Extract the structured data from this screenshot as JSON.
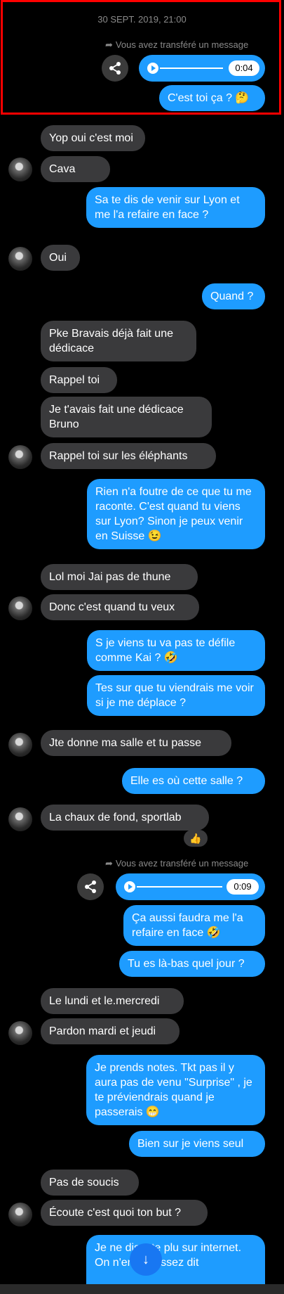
{
  "header": {
    "timestamp": "30 SEPT. 2019, 21:00"
  },
  "forward_notice": "Vous avez transféré un message",
  "icons": {
    "share": "share-icon",
    "play": "play-icon",
    "forward": "forward-arrow-icon",
    "scroll_down": "arrow-down-icon"
  },
  "colors": {
    "outgoing": "#1e9cff",
    "incoming": "#3a3a3c",
    "highlight": "#ff0000"
  },
  "audio": [
    {
      "duration": "0:04"
    },
    {
      "duration": "0:09"
    }
  ],
  "messages": [
    {
      "side": "out",
      "text": "C'est toi ça ? 🤔"
    },
    {
      "side": "in",
      "text": "Yop oui c'est moi"
    },
    {
      "side": "in",
      "text": "Cava"
    },
    {
      "side": "out",
      "text": "Sa te dis de venir sur Lyon et me l'a refaire en face ?"
    },
    {
      "side": "in",
      "text": "Oui"
    },
    {
      "side": "out",
      "text": "Quand ?"
    },
    {
      "side": "in",
      "text": "Pke Bravais déjà fait une dédicace"
    },
    {
      "side": "in",
      "text": "Rappel toi"
    },
    {
      "side": "in",
      "text": "Je t'avais fait une dédicace Bruno"
    },
    {
      "side": "in",
      "text": "Rappel toi sur les éléphants"
    },
    {
      "side": "out",
      "text": "Rien n'a foutre de ce que tu me raconte. C'est quand tu viens sur Lyon? Sinon je peux venir en Suisse 😉"
    },
    {
      "side": "in",
      "text": "Lol moi Jai pas de thune"
    },
    {
      "side": "in",
      "text": "Donc c'est quand tu veux"
    },
    {
      "side": "out",
      "text": "S je viens tu va pas te défile comme Kai ? 🤣"
    },
    {
      "side": "out",
      "text": "Tes sur que tu viendrais me voir si je me déplace ?"
    },
    {
      "side": "in",
      "text": "Jte donne ma salle et tu passe"
    },
    {
      "side": "out",
      "text": "Elle es où cette salle ?"
    },
    {
      "side": "in",
      "text": "La chaux de fond, sportlab"
    },
    {
      "side": "out",
      "text": "Ça aussi faudra me l'a refaire en face 🤣"
    },
    {
      "side": "out",
      "text": "Tu es là-bas quel jour ?"
    },
    {
      "side": "in",
      "text": "Le lundi et le.mercredi"
    },
    {
      "side": "in",
      "text": "Pardon mardi et jeudi"
    },
    {
      "side": "out",
      "text": "Je prends notes. Tkt pas il y aura pas de venu \"Surprise\" , je te préviendrais quand je passerais 😁"
    },
    {
      "side": "out",
      "text": "Bien sur je viens seul"
    },
    {
      "side": "in",
      "text": "Pas de soucis"
    },
    {
      "side": "in",
      "text": "Écoute c'est quoi ton but ?"
    },
    {
      "side": "out",
      "text": "Je ne discute plu sur internet. On n'en n'a assez dit"
    }
  ],
  "reaction": "👍"
}
